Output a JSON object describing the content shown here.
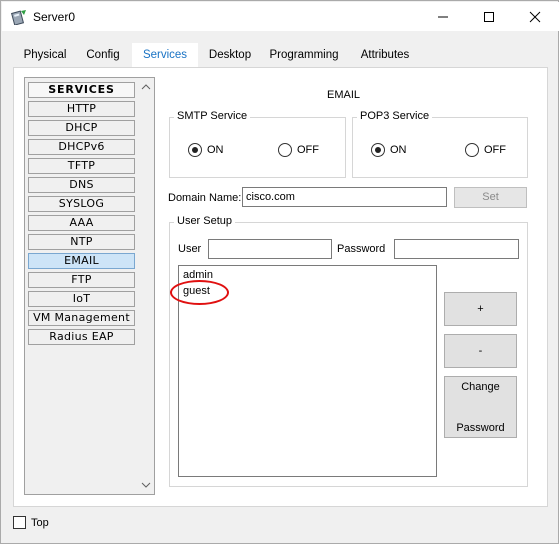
{
  "window": {
    "title": "Server0",
    "icon": "server-icon",
    "controls": [
      "minimize-icon",
      "maximize-icon",
      "close-icon"
    ]
  },
  "tabs": [
    {
      "label": "Physical",
      "active": false
    },
    {
      "label": "Config",
      "active": false
    },
    {
      "label": "Services",
      "active": true
    },
    {
      "label": "Desktop",
      "active": false
    },
    {
      "label": "Programming",
      "active": false
    },
    {
      "label": "Attributes",
      "active": false
    }
  ],
  "services": {
    "header": "SERVICES",
    "items": [
      "HTTP",
      "DHCP",
      "DHCPv6",
      "TFTP",
      "DNS",
      "SYSLOG",
      "AAA",
      "NTP",
      "EMAIL",
      "FTP",
      "IoT",
      "VM Management",
      "Radius EAP"
    ],
    "selected": "EMAIL"
  },
  "email": {
    "title": "EMAIL",
    "smtp": {
      "label": "SMTP Service",
      "on_label": "ON",
      "off_label": "OFF",
      "value": "ON"
    },
    "pop3": {
      "label": "POP3 Service",
      "on_label": "ON",
      "off_label": "OFF",
      "value": "ON"
    },
    "domain": {
      "label": "Domain Name:",
      "value": "cisco.com",
      "set_label": "Set"
    },
    "user_setup": {
      "label": "User Setup",
      "user_label": "User",
      "user_value": "",
      "password_label": "Password",
      "password_value": "",
      "users": [
        "admin",
        "guest"
      ],
      "highlighted_user": "guest",
      "add_label": "+",
      "remove_label": "-",
      "change_password_line1": "Change",
      "change_password_line2": "Password"
    }
  },
  "footer": {
    "top_label": "Top",
    "top_checked": false
  },
  "colors": {
    "accent": "#1a73c4",
    "highlight_circle": "#e01010",
    "selected_item": "#cde4f7"
  }
}
